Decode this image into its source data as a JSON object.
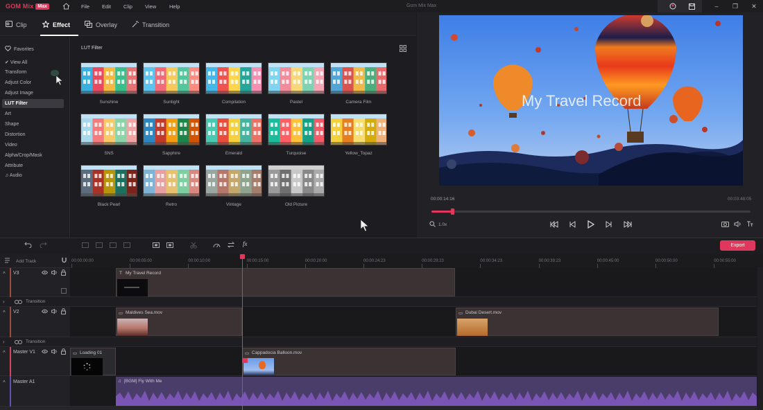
{
  "app": {
    "logo": "GOM Mix",
    "badge": "Max",
    "window_title": "Gom Mix Max",
    "menu": [
      "File",
      "Edit",
      "Clip",
      "View",
      "Help"
    ]
  },
  "tabs": [
    {
      "label": "Clip",
      "icon": "clip-icon"
    },
    {
      "label": "Effect",
      "icon": "star-icon",
      "active": true
    },
    {
      "label": "Overlay",
      "icon": "overlay-icon"
    },
    {
      "label": "Transition",
      "icon": "magic-wand-icon"
    }
  ],
  "sidebar": {
    "favorites": "Favorites",
    "items": [
      "View All",
      "Transform",
      "Adjust Color",
      "Adjust Image",
      "LUT Filter",
      "Art",
      "Shape",
      "Distortion",
      "Video",
      "Alpha/Crop/Mask",
      "Attribute",
      "Audio"
    ],
    "selected": "LUT Filter"
  },
  "filter_panel": {
    "title": "LUT Filter",
    "filters": [
      "Sunshine",
      "Sunlight",
      "Compilation",
      "Pastel",
      "Camera Film",
      "SNS",
      "Sapphire",
      "Emerald",
      "Turquoise",
      "Yellow_Topaz",
      "Black Pearl",
      "Retro",
      "Vintage",
      "Old Picture"
    ]
  },
  "preview": {
    "overlay_title": "My Travel Record",
    "current_time": "00:00:14:16",
    "total_time": "00:03:48:05",
    "zoom": "1.0x",
    "progress": 0.066
  },
  "timeline": {
    "export_label": "Export",
    "add_track": "Add Track",
    "ticks": [
      "00:00:00:00",
      "00:00:05:00",
      "00:00:10:00",
      "00:00:15:00",
      "00:00:20:00",
      "00:00:24:23",
      "00:00:29:23",
      "00:00:34:23",
      "00:00:39:23",
      "00:00:45:00",
      "00:00:50:00",
      "00:00:55:00"
    ],
    "transition_label": "Transition",
    "tracks": {
      "v3": {
        "name": "V3",
        "clips": [
          "My Travel Record"
        ]
      },
      "v2": {
        "name": "V2",
        "clips": [
          "Maldives Sea.mov",
          "Dubai Desert.mov"
        ]
      },
      "master_v1": {
        "name": "Master V1",
        "clips": [
          "Loading 01",
          "Cappadocia Balloon.mov"
        ]
      },
      "master_a1": {
        "name": "Master A1",
        "clips": [
          "[BGM] Fly With Me"
        ]
      }
    }
  },
  "colors": {
    "accent": "#e0375c",
    "audio_wave": "#7a55b5"
  }
}
